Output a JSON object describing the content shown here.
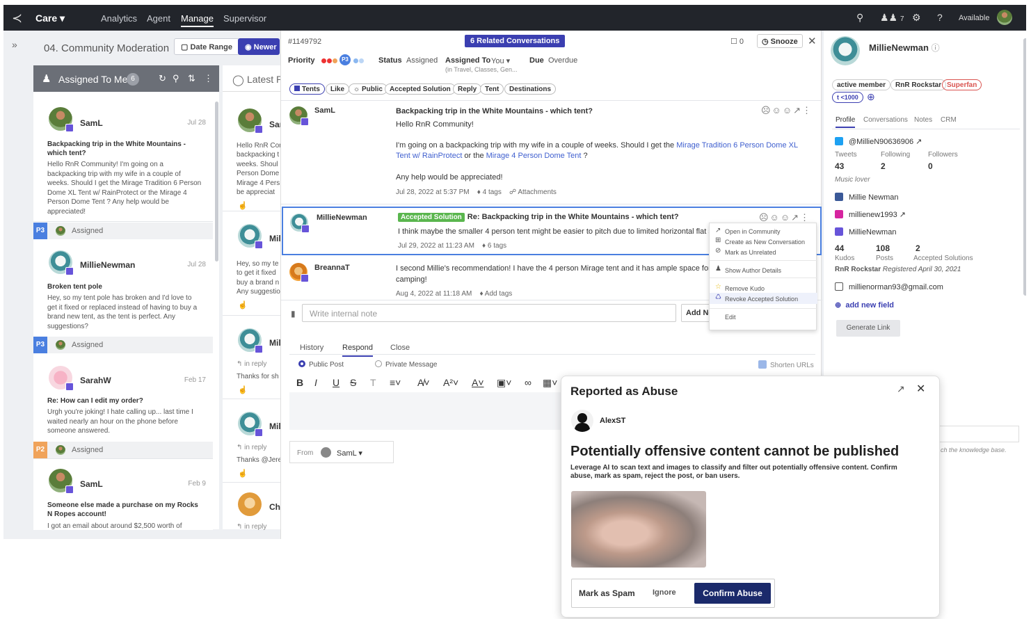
{
  "topbar": {
    "app": "Care",
    "nav": [
      "Analytics",
      "Agent",
      "Manage",
      "Supervisor"
    ],
    "users_count": "7",
    "status": "Available"
  },
  "header": {
    "title": "04. Community Moderation",
    "date_range": "Date Range",
    "newer": "Newer"
  },
  "queue": {
    "title": "Assigned To Me",
    "count": "6",
    "cards": [
      {
        "name": "SamL",
        "date": "Jul 28",
        "subject": "Backpacking trip in the White Mountains - which tent?",
        "body": "Hello RnR Community!  I'm going on a backpacking trip with my wife in a couple of weeks. Should I get the Mirage Tradition 6 Person Dome XL Tent w/ RainProtect  or the Mirage 4 Person Dome Tent ?  Any help would be appreciated!",
        "priority": "P3",
        "status": "Assigned"
      },
      {
        "name": "MillieNewman",
        "date": "Jul 28",
        "subject": "Broken tent pole",
        "body": "Hey, so my tent pole has broken and I'd love to get it fixed or replaced instead of having to buy a brand new tent, as the tent is perfect. Any suggestions?",
        "priority": "P3",
        "status": "Assigned"
      },
      {
        "name": "SarahW",
        "date": "Feb 17",
        "subject": "Re: How can I edit my order?",
        "body": "Urgh you're joking! I hate calling up... last time I waited nearly an hour on the phone before someone answered.",
        "priority": "P2",
        "status": "Assigned"
      },
      {
        "name": "SamL",
        "date": "Feb 9",
        "subject": "Someone else made a purchase on my Rocks N Ropes account!",
        "body": "I got an email about around $2,500 worth of",
        "priority": "",
        "status": ""
      }
    ]
  },
  "latest": {
    "title": "Latest P",
    "cards": [
      {
        "name": "Sar",
        "lines": [
          "Hello RnR Cor",
          "backpacking t",
          "weeks. Shoul",
          "Person Dome",
          "Mirage 4 Pers",
          "be appreciat"
        ]
      },
      {
        "name": "Mil",
        "lines": [
          "Hey, so my te",
          "to get it fixed",
          "buy a brand n",
          "Any suggestio"
        ]
      },
      {
        "name": "Mil",
        "inreply": "in reply",
        "lines": [
          "Thanks for sh"
        ]
      },
      {
        "name": "Mil",
        "inreply": "in reply",
        "lines": [
          "Thanks @Jere"
        ]
      },
      {
        "name": "Chr",
        "inreply": "in reply",
        "lines": []
      }
    ]
  },
  "conversation": {
    "id": "#1149792",
    "related": "6 Related Conversations",
    "bookmark_count": "0",
    "snooze": "Snooze",
    "priority_label": "Priority",
    "priority_chip": "P3",
    "status_label": "Status",
    "status_value": "Assigned",
    "assigned_label": "Assigned To",
    "assigned_value": "You",
    "assigned_sub": "(in Travel, Classes, Gen...",
    "due_label": "Due",
    "due_value": "Overdue",
    "tags": [
      "Tents",
      "Like",
      "Public",
      "Accepted Solution",
      "Reply",
      "Tent",
      "Destinations"
    ],
    "messages": [
      {
        "author": "SamL",
        "subject": "Backpacking trip in the White Mountains - which tent?",
        "greeting": "Hello RnR Community!",
        "body_pre": "I'm going on a backpacking trip with my wife in a couple of weeks. Should I get the ",
        "link1": "Mirage Tradition 6 Person Dome XL Tent w/ RainProtect",
        "mid": "  or the ",
        "link2": "Mirage 4 Person Dome Tent",
        "post": " ?",
        "closing": "Any help would be appreciated!",
        "time": "Jul 28, 2022 at 5:37 PM",
        "tags": "4 tags",
        "attach": "Attachments"
      },
      {
        "author": "MillieNewman",
        "badge": "Accepted Solution",
        "subject": "Re: Backpacking trip in the White Mountains - which tent?",
        "body": "I think maybe the smaller 4 person tent might be easier to pitch due to limited horizontal flat spac",
        "time": "Jul 29, 2022 at 11:23 AM",
        "tags": "6 tags"
      },
      {
        "author": "BreannaT",
        "body": "I second Millie's recommendation! I have the 4 person Mirage tent and it has ample space for two",
        "body2": "camping!",
        "time": "Aug 4, 2022 at 11:18 AM",
        "tags": "Add tags"
      }
    ],
    "note_placeholder": "Write internal note",
    "add_note": "Add Note",
    "tabs": [
      "History",
      "Respond",
      "Close"
    ],
    "public_post": "Public Post",
    "private_message": "Private Message",
    "shorten": "Shorten URLs",
    "from_label": "From",
    "from_user": "SamL"
  },
  "context_menu": [
    "Open in Community",
    "Create as New Conversation",
    "Mark as Unrelated",
    "Show Author Details",
    "Remove Kudo",
    "Revoke Accepted Solution",
    "Edit"
  ],
  "profile": {
    "name": "MillieNewman",
    "pills": [
      "active member",
      "RnR Rockstar",
      "Superfan",
      "<1000"
    ],
    "tabs": [
      "Profile",
      "Conversations",
      "Notes",
      "CRM"
    ],
    "twitter": "@MillieN90636906",
    "tweets_l": "Tweets",
    "tweets": "43",
    "following_l": "Following",
    "following": "2",
    "followers_l": "Followers",
    "followers": "0",
    "bio": "Music lover",
    "facebook": "Millie Newman",
    "instagram": "millienew1993",
    "community": "MillieNewman",
    "kudos": "44",
    "kudos_l": "Kudos",
    "posts": "108",
    "posts_l": "Posts",
    "solutions": "2",
    "solutions_l": "Accepted Solutions",
    "rank": "RnR Rockstar",
    "registered": "Registered April 30, 2021",
    "email": "millienorman93@gmail.com",
    "add_field": "add new field",
    "generate": "Generate Link",
    "kb_hint": "ch the knowledge base."
  },
  "abuse": {
    "title": "Reported as Abuse",
    "reporter": "AlexST",
    "headline": "Potentially offensive content cannot be published",
    "desc": "Leverage AI to scan text and images to classify and filter out potentially offensive content. Confirm abuse, mark as spam, reject the post, or ban users.",
    "spam": "Mark as Spam",
    "ignore": "Ignore",
    "confirm": "Confirm Abuse"
  },
  "colors": {
    "topbar": "#22252b",
    "accent": "#3b3fb1",
    "p3": "#4a7fe0",
    "p2": "#f0a35a",
    "success": "#5ab64e",
    "superfan": "#d9534f",
    "confirm": "#1b2a6b"
  }
}
